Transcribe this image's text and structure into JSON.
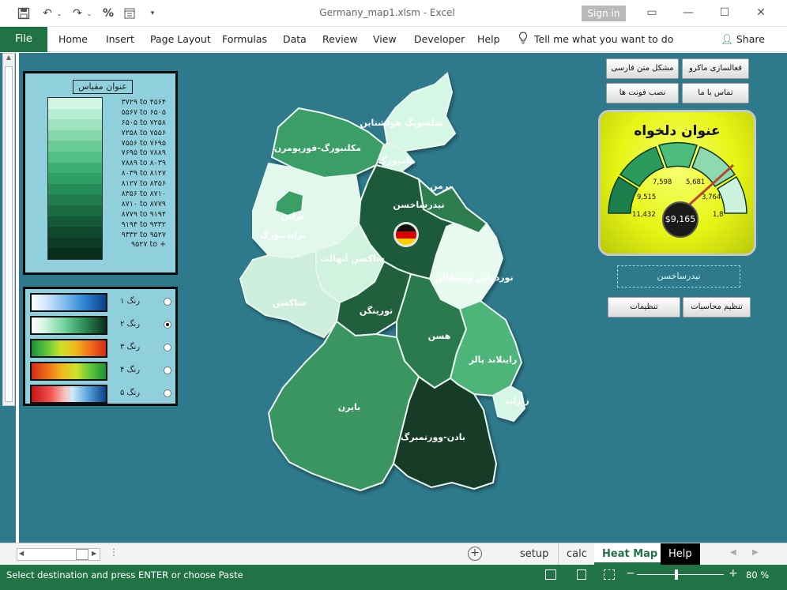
{
  "window": {
    "title": "Germany_map1.xlsm  -  Excel",
    "signin": "Sign in"
  },
  "qat": {
    "save_icon": "save-icon",
    "undo_icon": "undo-icon",
    "redo_icon": "redo-icon",
    "percent": "%",
    "form_icon": "form-icon",
    "customize_icon": "chevron-down-icon"
  },
  "ribbon": {
    "file": "File",
    "tabs": [
      "Home",
      "Insert",
      "Page Layout",
      "Formulas",
      "Data",
      "Review",
      "View",
      "Developer",
      "Help"
    ],
    "tell_me": "Tell me what you want to do",
    "share": "Share"
  },
  "legend": {
    "title": "عنوان مقیاس",
    "ranges": [
      "۳۷۲۹ to ۴۵۶۴",
      "۵۵۶۷ to ۶۵۰۵",
      "۶۵۰۵ to ۷۲۵۸",
      "۷۲۵۸ to ۷۵۵۶",
      "۷۵۵۶ to ۷۶۹۵",
      "۷۶۹۵ to ۷۸۸۹",
      "۷۸۸۹ to ۸۰۳۹",
      "۸۰۳۹ to ۸۱۲۷",
      "۸۱۲۷ to ۸۳۵۶",
      "۸۳۵۶ to ۸۷۱۰",
      "۸۷۱۰ to ۸۷۷۹",
      "۸۷۷۹ to ۹۱۹۴",
      "۹۱۹۴ to ۹۳۳۲",
      "۹۳۳۲ to ۹۵۲۷",
      "۹۵۲۷ to +"
    ],
    "band_colors": [
      "#d2f7e4",
      "#b7edd2",
      "#9ee3c0",
      "#84d7ab",
      "#6acb97",
      "#52bf84",
      "#3cb072",
      "#2ea064",
      "#268e58",
      "#1f7c4c",
      "#196b41",
      "#145a37",
      "#10492d",
      "#0c3a24",
      "#092d1c"
    ]
  },
  "schemes": [
    {
      "label": "رنگ ۱",
      "selected": false,
      "gradient": "linear-gradient(90deg,#ffffff,#cfe6fa 20%,#7dbbea 45%,#2f86d6 70%,#0b3f86)"
    },
    {
      "label": "رنگ ۲",
      "selected": true,
      "gradient": "linear-gradient(90deg,#ffffff,#c9f1dc 20%,#6fd09a 45%,#2e8f57 70%,#0b2f1c)"
    },
    {
      "label": "رنگ ۳",
      "selected": false,
      "gradient": "linear-gradient(90deg,#1e8f3a,#5cc63a 20%,#cfe22a 40%,#f2b41c 60%,#ef6a18 80%,#d42a1a)"
    },
    {
      "label": "رنگ ۴",
      "selected": false,
      "gradient": "linear-gradient(90deg,#d42a1a,#ef6a18 20%,#f2b41c 40%,#cfe22a 60%,#5cc63a 80%,#1e8f3a)"
    },
    {
      "label": "رنگ ۵",
      "selected": false,
      "gradient": "linear-gradient(90deg,#c8141a,#f0504c 25%,#f8c2c2 45%,#cfe8f8 55%,#5aa7e0 75%,#0d3f8a)"
    }
  ],
  "map": {
    "regions": {
      "sh": {
        "name": "شلسویگ هولشتاین",
        "color": "#d6f6e6"
      },
      "hh": {
        "name": "هامبورگ",
        "color": "#d6f6e6"
      },
      "mv": {
        "name": "مکلنبورگ-فورپومرن",
        "color": "#3b9e66"
      },
      "hb": {
        "name": "برمن",
        "color": "#2e7d50"
      },
      "ni": {
        "name": "نیدرساخسن",
        "color": "#1f5a3a"
      },
      "bb": {
        "name": "براندنبورگ",
        "color": "#e3f8ed"
      },
      "be": {
        "name": "برلین",
        "color": "#3b9e66"
      },
      "st": {
        "name": "ساکسن آنهالت",
        "color": "#d2f2e0"
      },
      "nw": {
        "name": "نوردراین وستفالن",
        "color": "#e9faf1"
      },
      "sn": {
        "name": "ساکسن",
        "color": "#cdeedc"
      },
      "th": {
        "name": "تورینگن",
        "color": "#215f3e"
      },
      "he": {
        "name": "هسن",
        "color": "#2b7a4d"
      },
      "rp": {
        "name": "راینلاند پالز",
        "color": "#4db57a"
      },
      "sl": {
        "name": "زارلند",
        "color": "#d6f6e6"
      },
      "by": {
        "name": "بایرن",
        "color": "#3a9561"
      },
      "bw": {
        "name": "بادن-وورتمبرگ",
        "color": "#123b26"
      }
    }
  },
  "buttons": {
    "macro": "فعالسازی ماکرو",
    "persian": "مشکل متن فارسی",
    "contact": "تماس با ما",
    "fonts": "نصب فونت ها",
    "calc_settings": "تنظیم محاسبات",
    "settings": "تنظیمات"
  },
  "gauge": {
    "title": "عنوان دلخواه",
    "value": "$9,165",
    "ticks": [
      "7,598",
      "5,681",
      "9,515",
      "3,764",
      "11,432",
      "1,8"
    ]
  },
  "selected_region": "نیدرساخسن",
  "sheet_tabs": {
    "add_icon": "plus-circle-icon",
    "tabs": [
      "setup",
      "calc",
      "Heat Map",
      "Help"
    ],
    "active": "Heat Map"
  },
  "status": {
    "text": "Select destination and press ENTER or choose Paste",
    "zoom": "80 %"
  }
}
